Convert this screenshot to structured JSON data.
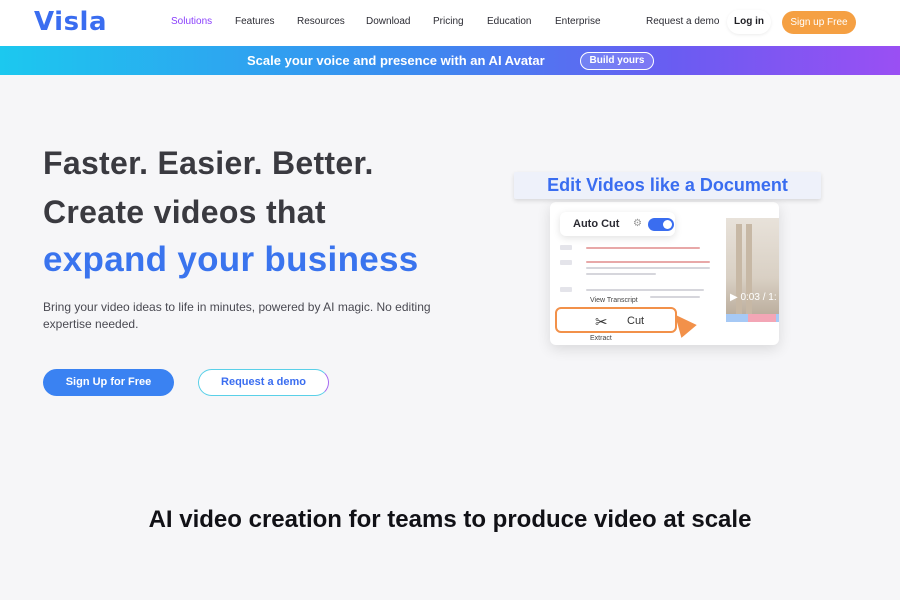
{
  "brand": {
    "logo": "Visla",
    "accent": "#3a6df0",
    "signup_color": "#f5a043"
  },
  "nav": {
    "links": [
      "Solutions",
      "Features",
      "Resources",
      "Download",
      "Pricing",
      "Education",
      "Enterprise"
    ],
    "active": "Solutions",
    "demo": "Request a demo",
    "login": "Log in",
    "signup": "Sign up Free"
  },
  "banner": {
    "text": "Scale your voice and presence with an AI Avatar",
    "button": "Build yours"
  },
  "hero": {
    "line1": "Faster. Easier. Better.",
    "line2": "Create videos that",
    "line3": "expand your business",
    "subtitle": "Bring your video ideas to life in minutes, powered by AI magic. No editing expertise needed.",
    "primary_button": "Sign Up for Free",
    "secondary_button": "Request a demo"
  },
  "mock": {
    "title": "Edit Videos like a Document",
    "autocut_label": "Auto Cut",
    "autocut_on": true,
    "view_transcript": "View Transcript",
    "cut_label": "Cut",
    "extract_label": "Extract",
    "video_time": "▶ 0:03 / 1:"
  },
  "section": {
    "title": "AI video creation for teams to produce video at scale"
  }
}
